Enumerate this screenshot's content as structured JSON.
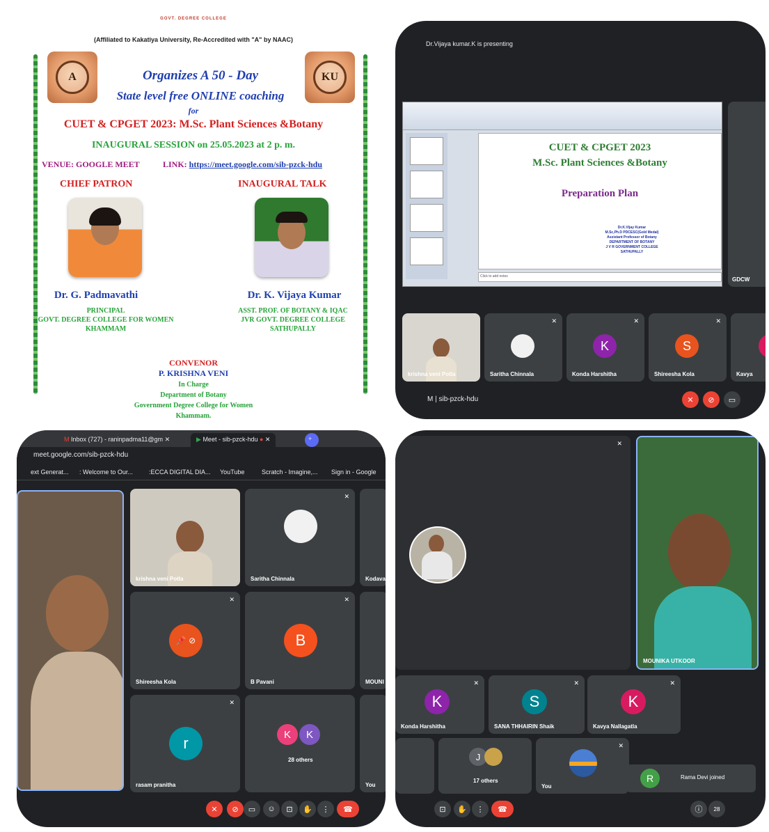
{
  "poster": {
    "college": "GOVT. DEGREE COLLEGE",
    "affiliation": "(Affiliated to Kakatiya University, Re-Accredited with \"A\" by NAAC)",
    "line1": "Organizes A 50 - Day",
    "line2": "State level free ONLINE coaching",
    "line3": "for",
    "line4": "CUET & CPGET 2023: M.Sc. Plant Sciences &Botany",
    "line5": "INAUGURAL SESSION on 25.05.2023 at 2 p. m.",
    "venue": "VENUE: GOOGLE MEET",
    "link_label": "LINK:",
    "link_url": "https://meet.google.com/sib-pzck-hdu",
    "chief_patron_heading": "CHIEF PATRON",
    "inaugural_heading": "INAUGURAL TALK",
    "left_seal_text": "A",
    "right_seal_text": "KU",
    "patron_name": "Dr. G. Padmavathi",
    "patron_desc_1": "PRINCIPAL",
    "patron_desc_2": "GOVT. DEGREE COLLEGE FOR WOMEN",
    "patron_desc_3": "KHAMMAM",
    "speaker_name": "Dr. K. Vijaya Kumar",
    "speaker_desc_1": "ASST. PROF. OF BOTANY & IQAC",
    "speaker_desc_2": "JVR GOVT. DEGREE COLLEGE",
    "speaker_desc_3": "SATHUPALLY",
    "convenor_heading": "CONVENOR",
    "convenor_name": "P. KRISHNA VENI",
    "convenor_1": "In Charge",
    "convenor_2": "Department of Botany",
    "convenor_3": "Government Degree College for Women",
    "convenor_4": "Khammam."
  },
  "meet1": {
    "presenting": "Dr.Vijaya kumar.K is presenting",
    "slide_title_1": "CUET & CPGET 2023",
    "slide_title_2": "M.Sc. Plant Sciences &Botany",
    "slide_subtitle": "Preparation Plan",
    "slide_author": "Dr.K.Vijay Kumar",
    "slide_author_2": "M.Sc,Ph.D PDCESC(Gold Medal)",
    "slide_author_3": "Assistant Professor of Botany",
    "slide_author_4": "DEPARTMENT OF BOTANY",
    "slide_author_5": "J V R GOVERNMENT COLLEGE",
    "slide_author_6": "SATHUPALLY",
    "notes_placeholder": "Click to add notes",
    "side_tile": "GDCW",
    "participants": [
      {
        "name": "krishna veni Potla",
        "initial": ""
      },
      {
        "name": "Saritha Chinnala",
        "initial": ""
      },
      {
        "name": "Konda Harshitha",
        "initial": "K"
      },
      {
        "name": "Shireesha Kola",
        "initial": "S"
      },
      {
        "name": "Kavya",
        "initial": ""
      }
    ],
    "meeting_code": "M  |  sib-pzck-hdu"
  },
  "meet2": {
    "tabs": [
      "Inbox (727) - raninpadma11@gm",
      "Meet - sib-pzck-hdu"
    ],
    "url": "meet.google.com/sib-pzck-hdu",
    "bookmarks": [
      "ext Generat...",
      ": Welcome to Our...",
      ":ECCA DIGITAL DIA...",
      "YouTube",
      "Scratch - Imagine,...",
      "Sign in - Google"
    ],
    "tiles": [
      {
        "name": "krishna veni Potla",
        "initial": ""
      },
      {
        "name": "Saritha Chinnala",
        "initial": ""
      },
      {
        "name": "Kodavat",
        "initial": ""
      },
      {
        "name": "Shireesha Kola",
        "initial": ""
      },
      {
        "name": "B Pavani",
        "initial": "B"
      },
      {
        "name": "MOUNI",
        "initial": ""
      },
      {
        "name": "rasam pranitha",
        "initial": "r"
      },
      {
        "name": "28 others",
        "initial": "K"
      },
      {
        "name": "You",
        "initial": ""
      }
    ]
  },
  "meet3": {
    "main_name": "MOUNIKA UTKOOR",
    "tiles": [
      {
        "name": "Konda Harshitha",
        "initial": "K"
      },
      {
        "name": "SANA THHAIRIN Shaik",
        "initial": "S"
      },
      {
        "name": "Kavya Nallagatla",
        "initial": "K"
      },
      {
        "name": "17 others",
        "initial": "J"
      },
      {
        "name": "You",
        "initial": ""
      }
    ],
    "toast_initial": "R",
    "toast_text": "Rama Devi joined",
    "people_count": "28"
  }
}
